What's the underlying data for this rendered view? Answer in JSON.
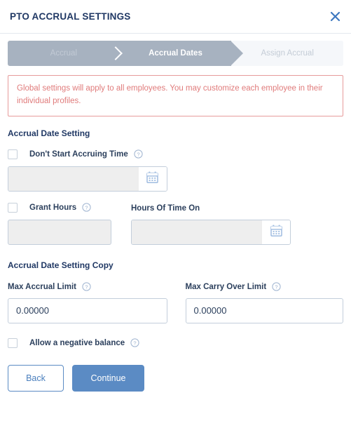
{
  "header": {
    "title": "PTO ACCRUAL SETTINGS",
    "close_icon": "close-icon"
  },
  "stepper": {
    "steps": [
      {
        "label": "Accrual",
        "state": "done"
      },
      {
        "label": "Accrual Dates",
        "state": "active"
      },
      {
        "label": "Assign Accrual",
        "state": "todo"
      }
    ]
  },
  "alert": {
    "text": "Global settings will apply to all employees. You may customize each employee in their individual profiles.",
    "border_color": "#e79b9b",
    "text_color": "#e07b7b"
  },
  "accrual_date_setting": {
    "title": "Accrual Date Setting",
    "dont_start_accruing": {
      "label": "Don't Start Accruing Time",
      "checked": false,
      "help_icon": "help-icon",
      "input_value": "",
      "calendar_icon": "calendar-icon"
    },
    "grant_hours": {
      "label": "Grant Hours",
      "checked": false,
      "help_icon": "help-icon",
      "input_value": ""
    },
    "hours_of_time_on": {
      "label": "Hours Of Time On",
      "input_value": "",
      "calendar_icon": "calendar-icon"
    }
  },
  "accrual_date_setting_copy": {
    "title": "Accrual Date Setting Copy",
    "max_accrual_limit": {
      "label": "Max Accrual Limit",
      "help_icon": "help-icon",
      "value": "0.00000"
    },
    "max_carry_over_limit": {
      "label": "Max Carry Over Limit",
      "help_icon": "help-icon",
      "value": "0.00000"
    }
  },
  "allow_negative_balance": {
    "label": "Allow a negative balance",
    "checked": false,
    "help_icon": "help-icon"
  },
  "footer": {
    "back_label": "Back",
    "continue_label": "Continue",
    "primary_color": "#5b8bc4"
  }
}
